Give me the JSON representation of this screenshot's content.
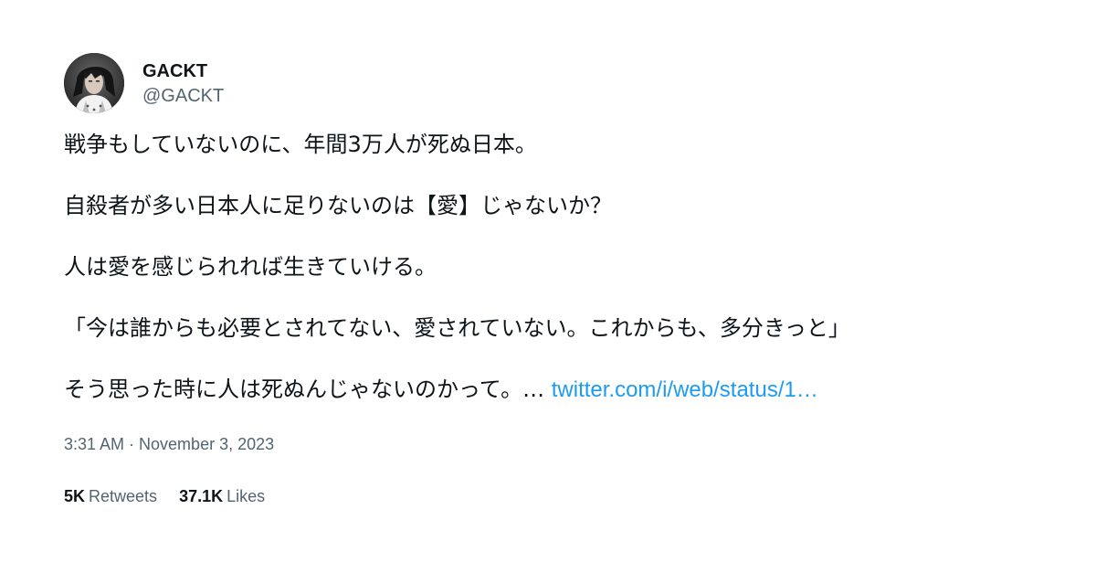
{
  "author": {
    "display_name": "GACKT",
    "handle": "@GACKT",
    "avatar_icon": "avatar-photo"
  },
  "tweet": {
    "lines": [
      "戦争もしていないのに、年間3万人が死ぬ日本。",
      "自殺者が多い日本人に足りないのは【愛】じゃないか？",
      "人は愛を感じられれば生きていける。",
      "「今は誰からも必要とされてない、愛されていない。これからも、多分きっと」",
      "そう思った時に人は死ぬんじゃないのかって。…"
    ],
    "link_text": "twitter.com/i/web/status/1…"
  },
  "timestamp": "3:31 AM · November 3, 2023",
  "stats": {
    "retweets": {
      "count": "5K",
      "label": "Retweets"
    },
    "likes": {
      "count": "37.1K",
      "label": "Likes"
    }
  },
  "colors": {
    "text_primary": "#0f1419",
    "text_secondary": "#536471",
    "link": "#1d9bf0",
    "background": "#ffffff"
  }
}
